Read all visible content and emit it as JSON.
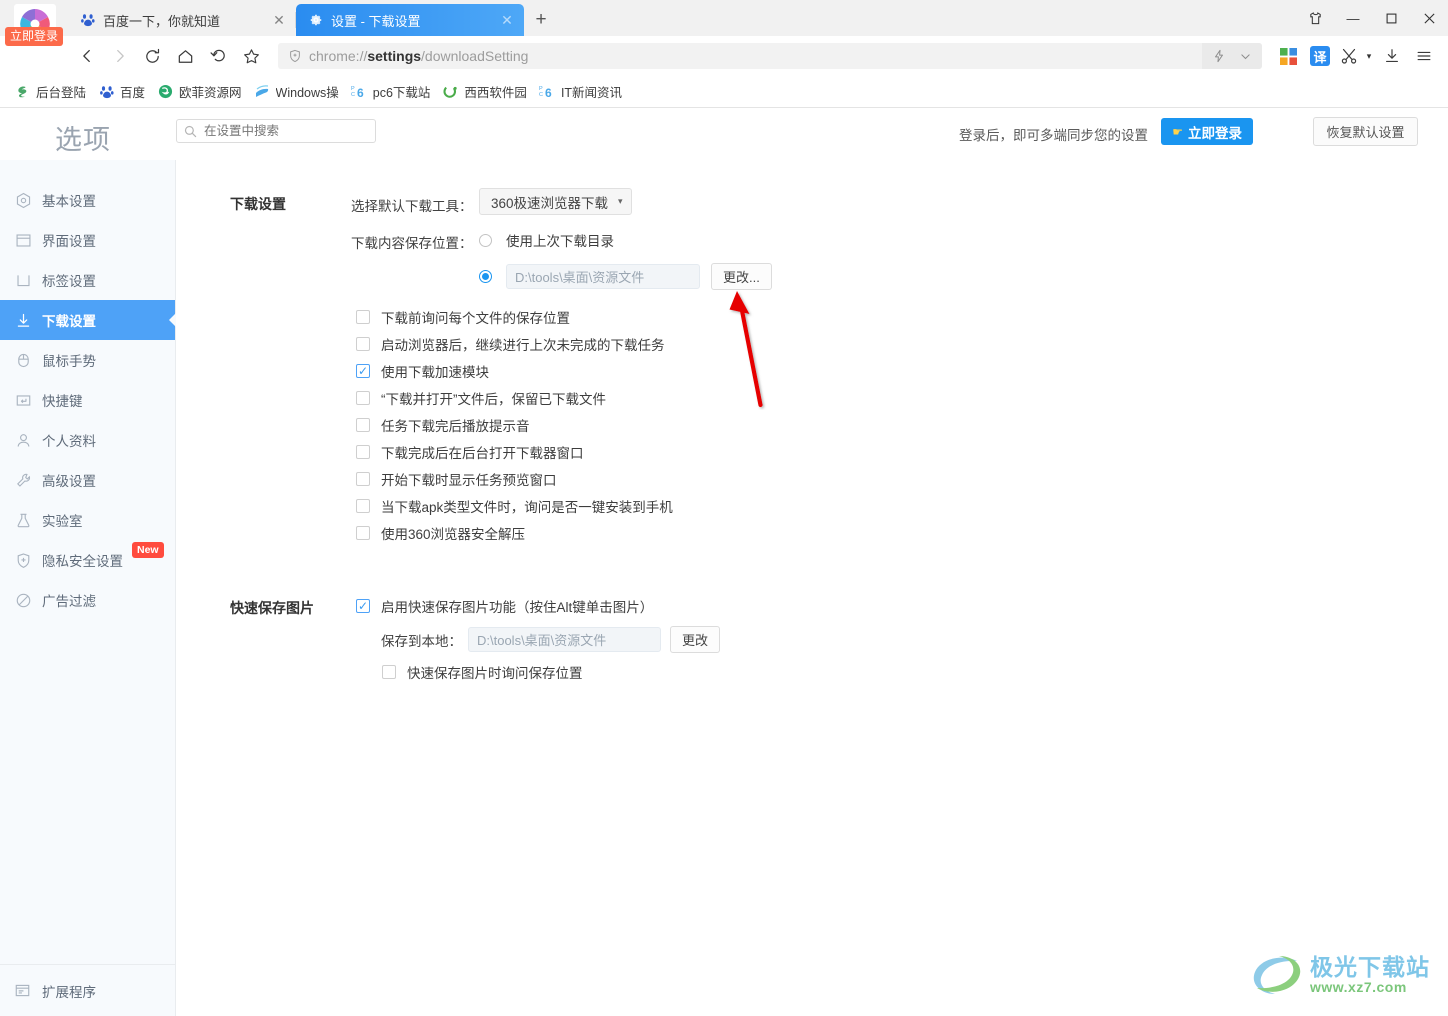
{
  "window": {
    "controls": [
      {
        "name": "skin-icon",
        "glyph": "👕"
      },
      {
        "name": "minimize",
        "glyph": "—"
      },
      {
        "name": "maximize",
        "glyph": "☐"
      },
      {
        "name": "close",
        "glyph": "✕"
      }
    ]
  },
  "browser": {
    "login_badge": "立即登录",
    "tabs": [
      {
        "title": "百度一下，你就知道",
        "favicon": "baidu-icon",
        "active": false,
        "close": "✕"
      },
      {
        "title": "设置 - 下载设置",
        "favicon": "gear-icon",
        "active": true,
        "close": "✕"
      }
    ],
    "new_tab_label": "+",
    "toolbar": {
      "back": "‹",
      "forward": "›",
      "reload": "⟳",
      "home": "⌂",
      "restore": "↺",
      "bookmark": "☆",
      "url_prefix": "chrome://",
      "url_bold": "settings",
      "url_suffix": "/downloadSetting",
      "lightning": "⚡",
      "chevron": "⌄",
      "translate_label": "译",
      "scissors": "✂",
      "scissors_caret": "▾",
      "download": "↓",
      "menu": "☰"
    },
    "bookmarks": [
      {
        "label": "后台登陆",
        "icon": "s-icon"
      },
      {
        "label": "百度",
        "icon": "baidu-icon"
      },
      {
        "label": "欧菲资源网",
        "icon": "globe-icon"
      },
      {
        "label": "Windows操",
        "icon": "windows-icon"
      },
      {
        "label": "pc6下载站",
        "icon": "pc6-icon"
      },
      {
        "label": "西西软件园",
        "icon": "g-icon"
      },
      {
        "label": "IT新闻资讯",
        "icon": "pc6-icon"
      }
    ]
  },
  "settings_header": {
    "title": "选项",
    "search_placeholder": "在设置中搜索",
    "search_value": "",
    "sync_text": "登录后，即可多端同步您的设置",
    "login_button": "立即登录",
    "reset_button": "恢复默认设置"
  },
  "sidebar": {
    "items": [
      {
        "label": "基本设置",
        "icon": "hexagon-target-icon",
        "active": false
      },
      {
        "label": "界面设置",
        "icon": "window-icon",
        "active": false
      },
      {
        "label": "标签设置",
        "icon": "tab-icon",
        "active": false
      },
      {
        "label": "下载设置",
        "icon": "download-arrow-icon",
        "active": true
      },
      {
        "label": "鼠标手势",
        "icon": "mouse-icon",
        "active": false
      },
      {
        "label": "快捷键",
        "icon": "keyboard-key-icon",
        "active": false
      },
      {
        "label": "个人资料",
        "icon": "person-icon",
        "active": false
      },
      {
        "label": "高级设置",
        "icon": "wrench-icon",
        "active": false
      },
      {
        "label": "实验室",
        "icon": "flask-icon",
        "active": false
      },
      {
        "label": "隐私安全设置",
        "icon": "shield-plus-icon",
        "active": false,
        "badge": "New"
      },
      {
        "label": "广告过滤",
        "icon": "block-icon",
        "active": false
      }
    ],
    "bottom_item": {
      "label": "扩展程序",
      "icon": "extension-icon"
    }
  },
  "main": {
    "download_section": {
      "title": "下载设置",
      "tool_label": "选择默认下载工具：",
      "tool_value": "360极速浏览器下载",
      "tool_caret": "▾",
      "location_label": "下载内容保存位置：",
      "radio_last_dir": {
        "label": "使用上次下载目录",
        "selected": false
      },
      "radio_custom": {
        "selected": true,
        "path": "D:\\tools\\桌面\\资源文件",
        "button": "更改..."
      },
      "checkboxes": [
        {
          "label": "下载前询问每个文件的保存位置",
          "checked": false
        },
        {
          "label": "启动浏览器后，继续进行上次未完成的下载任务",
          "checked": false
        },
        {
          "label": "使用下载加速模块",
          "checked": true
        },
        {
          "label": "“下载并打开”文件后，保留已下载文件",
          "checked": false
        },
        {
          "label": "任务下载完后播放提示音",
          "checked": false
        },
        {
          "label": "下载完成后在后台打开下载器窗口",
          "checked": false
        },
        {
          "label": "开始下载时显示任务预览窗口",
          "checked": false
        },
        {
          "label": "当下载apk类型文件时，询问是否一键安装到手机",
          "checked": false
        },
        {
          "label": "使用360浏览器安全解压",
          "checked": false
        }
      ]
    },
    "quicksave_section": {
      "title": "快速保存图片",
      "enable": {
        "label": "启用快速保存图片功能（按住Alt键单击图片）",
        "checked": true
      },
      "save_label": "保存到本地：",
      "save_path": "D:\\tools\\桌面\\资源文件",
      "save_button": "更改",
      "ask_location": {
        "label": "快速保存图片时询问保存位置",
        "checked": false
      }
    }
  },
  "watermark": {
    "main": "极光下载站",
    "sub": "www.xz7.com"
  },
  "colors": {
    "accent_blue": "#4ea2f7",
    "tab_active": "#2a8cf0",
    "login_blue": "#1a95f0",
    "badge_red": "#ff4b3e",
    "login_badge_orange": "#fc6a4a",
    "arrow_red": "#e60000"
  }
}
